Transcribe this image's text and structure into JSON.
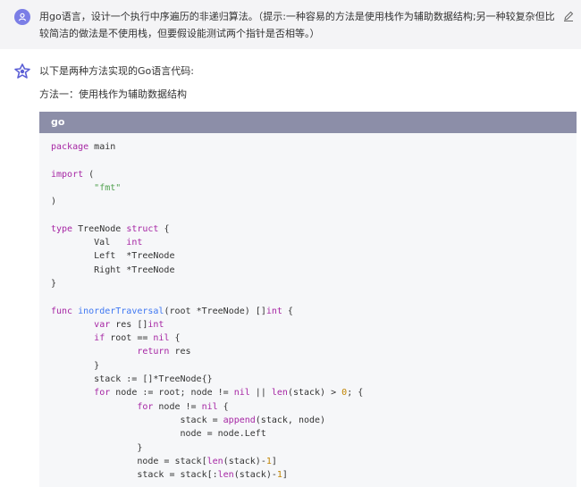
{
  "user_message": {
    "text": "用go语言，设计一个执行中序遍历的非递归算法。（提示:一种容易的方法是使用栈作为辅助数据结构;另一种较复杂但比较简洁的做法是不使用栈，但要假设能测试两个指针是否相等。）",
    "avatar_icon": "user-avatar-icon",
    "edit_icon": "pencil-icon"
  },
  "assistant": {
    "avatar_icon": "assistant-logo-icon",
    "intro": "以下是两种方法实现的Go语言代码:",
    "method_one_label": "方法一：使用栈作为辅助数据结构"
  },
  "code_block": {
    "language": "go",
    "lines": [
      "package main",
      "",
      "import (",
      "        \"fmt\"",
      ")",
      "",
      "type TreeNode struct {",
      "        Val   int",
      "        Left  *TreeNode",
      "        Right *TreeNode",
      "}",
      "",
      "func inorderTraversal(root *TreeNode) []int {",
      "        var res []int",
      "        if root == nil {",
      "                return res",
      "        }",
      "        stack := []*TreeNode{}",
      "        for node := root; node != nil || len(stack) > 0; {",
      "                for node != nil {",
      "                        stack = append(stack, node)",
      "                        node = node.Left",
      "                }",
      "                node = stack[len(stack)-1]",
      "                stack = stack[:len(stack)-1]"
    ]
  },
  "colors": {
    "user_bar_bg": "#f4f4f6",
    "code_header_bg": "#8c8ea8",
    "code_bg": "#f6f7f9",
    "avatar": "#7b7ee6"
  }
}
